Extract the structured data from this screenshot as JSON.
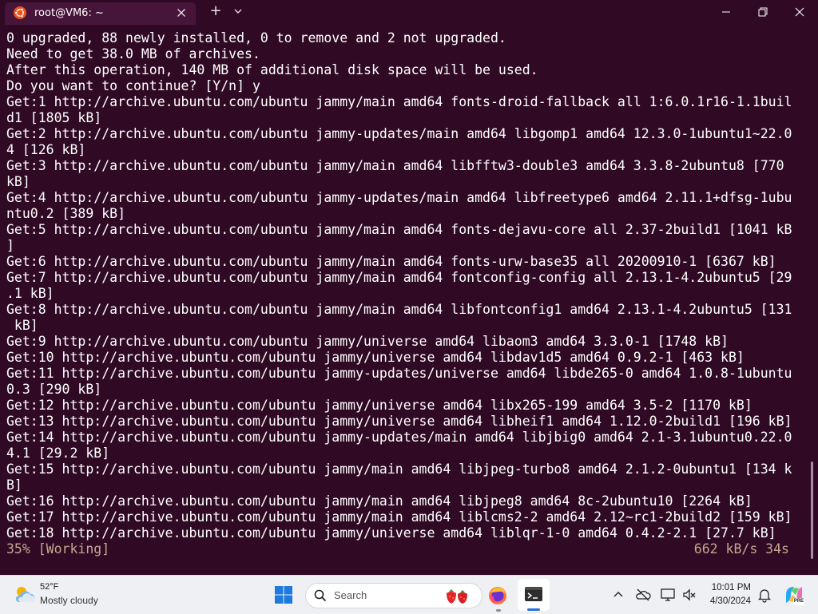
{
  "window": {
    "tab_title": "root@VM6: ~",
    "tab_icon": "ubuntu-logo-icon",
    "new_tab_label": "+"
  },
  "terminal": {
    "lines": [
      "0 upgraded, 88 newly installed, 0 to remove and 2 not upgraded.",
      "Need to get 38.0 MB of archives.",
      "After this operation, 140 MB of additional disk space will be used.",
      "Do you want to continue? [Y/n] y",
      "Get:1 http://archive.ubuntu.com/ubuntu jammy/main amd64 fonts-droid-fallback all 1:6.0.1r16-1.1buil",
      "d1 [1805 kB]",
      "Get:2 http://archive.ubuntu.com/ubuntu jammy-updates/main amd64 libgomp1 amd64 12.3.0-1ubuntu1~22.0",
      "4 [126 kB]",
      "Get:3 http://archive.ubuntu.com/ubuntu jammy/main amd64 libfftw3-double3 amd64 3.3.8-2ubuntu8 [770",
      "kB]",
      "Get:4 http://archive.ubuntu.com/ubuntu jammy-updates/main amd64 libfreetype6 amd64 2.11.1+dfsg-1ubu",
      "ntu0.2 [389 kB]",
      "Get:5 http://archive.ubuntu.com/ubuntu jammy/main amd64 fonts-dejavu-core all 2.37-2build1 [1041 kB",
      "]",
      "Get:6 http://archive.ubuntu.com/ubuntu jammy/main amd64 fonts-urw-base35 all 20200910-1 [6367 kB]",
      "Get:7 http://archive.ubuntu.com/ubuntu jammy/main amd64 fontconfig-config all 2.13.1-4.2ubuntu5 [29",
      ".1 kB]",
      "Get:8 http://archive.ubuntu.com/ubuntu jammy/main amd64 libfontconfig1 amd64 2.13.1-4.2ubuntu5 [131",
      " kB]",
      "Get:9 http://archive.ubuntu.com/ubuntu jammy/universe amd64 libaom3 amd64 3.3.0-1 [1748 kB]",
      "Get:10 http://archive.ubuntu.com/ubuntu jammy/universe amd64 libdav1d5 amd64 0.9.2-1 [463 kB]",
      "Get:11 http://archive.ubuntu.com/ubuntu jammy-updates/universe amd64 libde265-0 amd64 1.0.8-1ubuntu",
      "0.3 [290 kB]",
      "Get:12 http://archive.ubuntu.com/ubuntu jammy/universe amd64 libx265-199 amd64 3.5-2 [1170 kB]",
      "Get:13 http://archive.ubuntu.com/ubuntu jammy/universe amd64 libheif1 amd64 1.12.0-2build1 [196 kB]",
      "Get:14 http://archive.ubuntu.com/ubuntu jammy-updates/main amd64 libjbig0 amd64 2.1-3.1ubuntu0.22.0",
      "4.1 [29.2 kB]",
      "Get:15 http://archive.ubuntu.com/ubuntu jammy/main amd64 libjpeg-turbo8 amd64 2.1.2-0ubuntu1 [134 k",
      "B]",
      "Get:16 http://archive.ubuntu.com/ubuntu jammy/main amd64 libjpeg8 amd64 8c-2ubuntu10 [2264 kB]",
      "Get:17 http://archive.ubuntu.com/ubuntu jammy/main amd64 liblcms2-2 amd64 2.12~rc1-2build2 [159 kB]",
      "Get:18 http://archive.ubuntu.com/ubuntu jammy/universe amd64 liblqr-1-0 amd64 0.4.2-2.1 [27.7 kB]"
    ],
    "status_left": "35% [Working]",
    "status_right": "662 kB/s 34s"
  },
  "taskbar": {
    "weather_temp": "52°F",
    "weather_desc": "Mostly cloudy",
    "search_placeholder": "Search",
    "clock_time": "10:01 PM",
    "clock_date": "4/30/2024",
    "copilot_badge": "PRE"
  },
  "colors": {
    "terminal_bg": "#300a24",
    "terminal_fg": "#ffffff",
    "status_fg": "#c4a88f",
    "taskbar_bg": "#eef0f3",
    "accent": "#2a6fd6"
  }
}
